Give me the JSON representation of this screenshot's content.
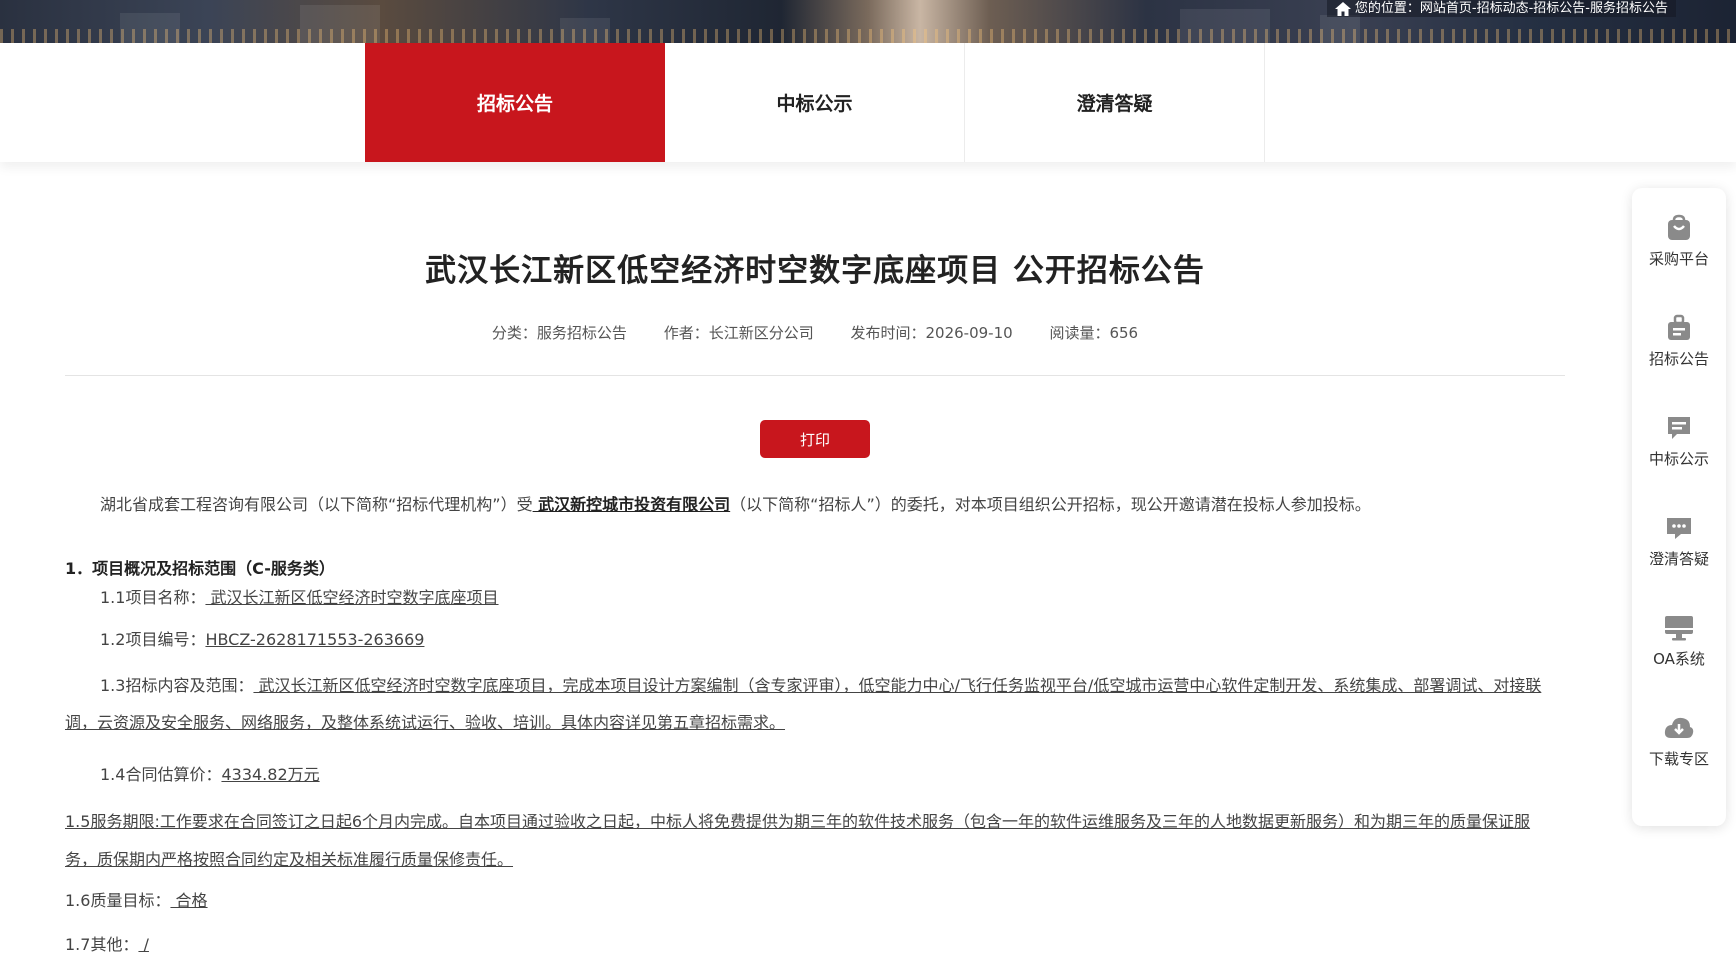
{
  "breadcrumb": {
    "text": "您的位置：网站首页-招标动态-招标公告-服务招标公告"
  },
  "tabs": [
    {
      "label": "招标公告",
      "active": true
    },
    {
      "label": "中标公示",
      "active": false
    },
    {
      "label": "澄清答疑",
      "active": false
    }
  ],
  "article": {
    "title": "武汉长江新区低空经济时空数字底座项目 公开招标公告",
    "meta": {
      "category": "分类：服务招标公告",
      "author": "作者：长江新区分公司",
      "date": "发布时间：2026-09-10",
      "views": "阅读量：656"
    },
    "print_label": "打印",
    "intro_a": "湖北省成套工程咨询有限公司（以下简称“招标代理机构”）受",
    "intro_b": " 武汉新控城市投资有限公司",
    "intro_c": "（以下简称“招标人”）的委托，对本项目组织公开招标，现公开邀请潜在投标人参加投标。",
    "section1": "1．项目概况及招标范围（C-服务类）",
    "item11_label": "1.1项目名称：",
    "item11_value": "  武汉长江新区低空经济时空数字底座项目   ",
    "item12_label": "1.2项目编号：",
    "item12_value": "HBCZ-2628171553-263669",
    "item13_label": "1.3招标内容及范围：",
    "item13_value": "  武汉长江新区低空经济时空数字底座项目，完成本项目设计方案编制（含专家评审），低空能力中心/飞行任务监视平台/低空城市运营中心软件定制开发、系统集成、部署调试、对接联调，云资源及安全服务、网络服务，及整体系统试运行、验收、培训。具体内容详见第五章招标需求。   ",
    "item14_label": "1.4合同估算价：",
    "item14_value": "4334.82万元   ",
    "item15": "1.5服务期限:工作要求在合同签订之日起6个月内完成。自本项目通过验收之日起，中标人将免费提供为期三年的软件技术服务（包含一年的软件运维服务及三年的人地数据更新服务）和为期三年的质量保证服务，质保期内严格按照合同约定及相关标准履行质量保修责任。   ",
    "item16_label": "1.6质量目标：",
    "item16_value": " 合格  ",
    "item17_label": "1.7其他：",
    "item17_value": "  /   "
  },
  "sidepanel": [
    {
      "label": "采购平台",
      "icon": "shopping-bag-icon"
    },
    {
      "label": "招标公告",
      "icon": "briefcase-icon"
    },
    {
      "label": "中标公示",
      "icon": "message-list-icon"
    },
    {
      "label": "澄清答疑",
      "icon": "chat-bubble-icon"
    },
    {
      "label": "OA系统",
      "icon": "monitor-icon"
    },
    {
      "label": "下载专区",
      "icon": "cloud-download-icon"
    }
  ],
  "colors": {
    "accent": "#c8161d"
  }
}
